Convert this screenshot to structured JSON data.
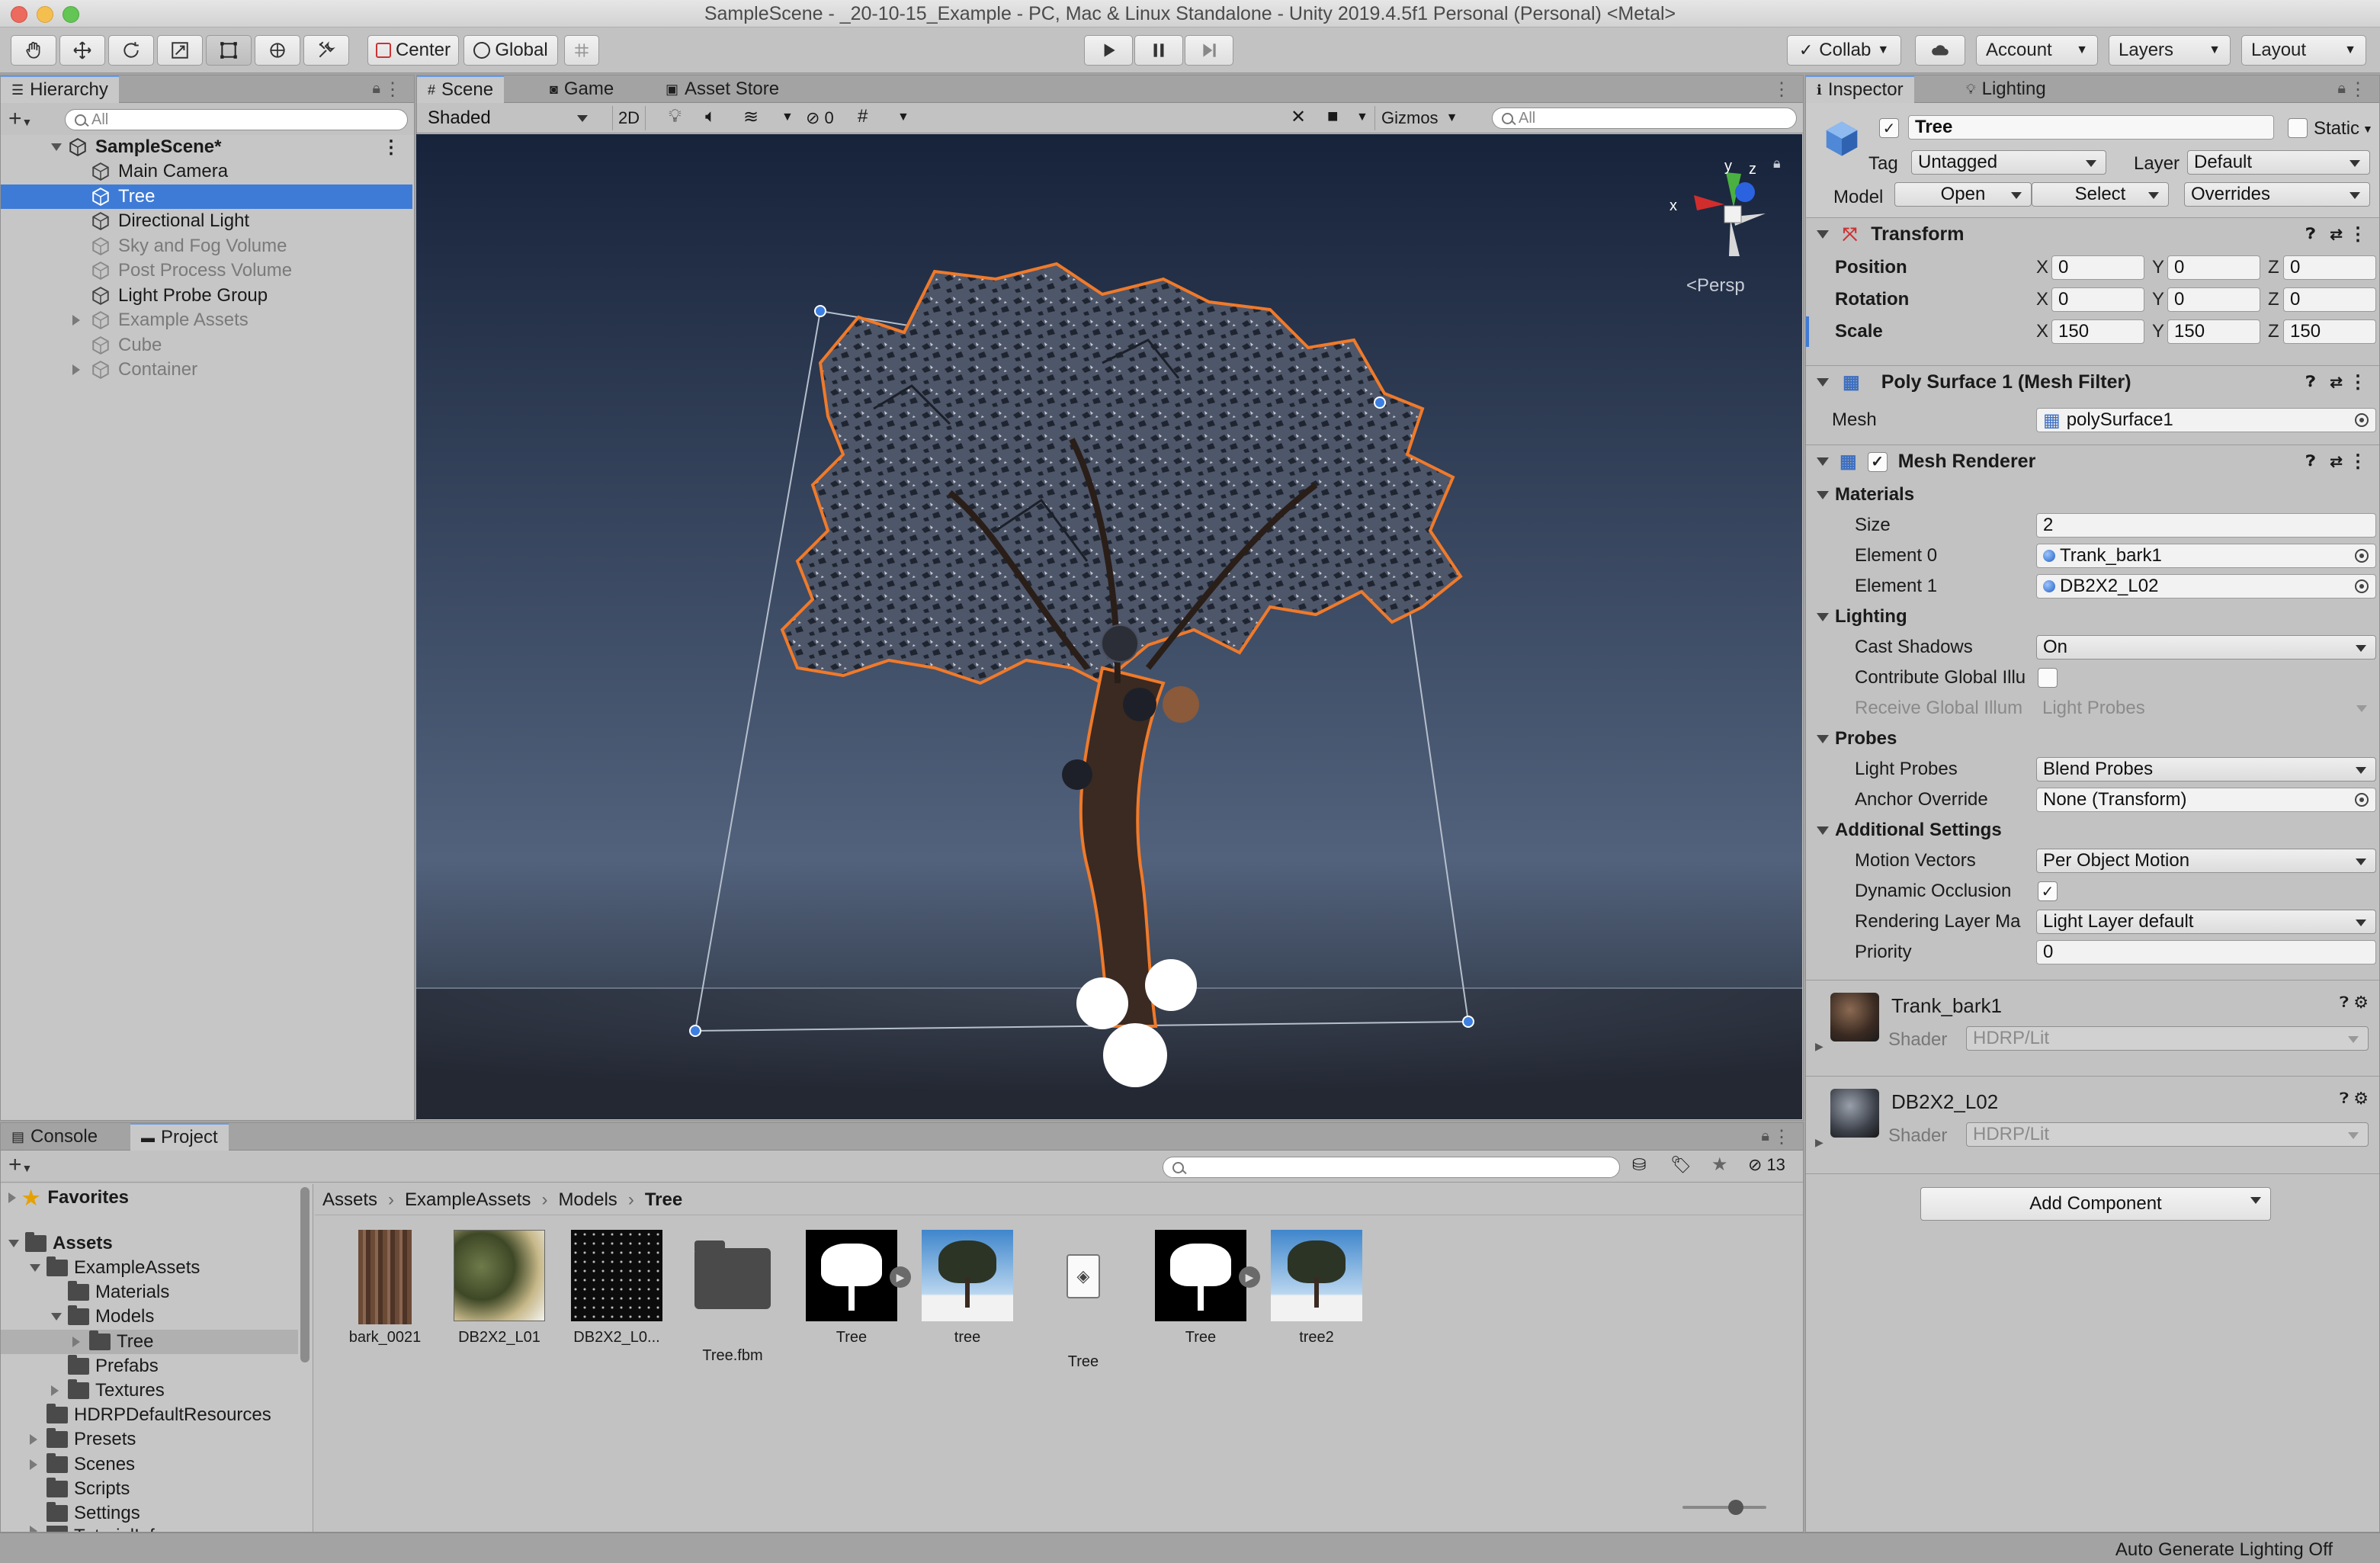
{
  "window": {
    "title": "SampleScene - _20-10-15_Example - PC, Mac & Linux Standalone - Unity 2019.4.5f1 Personal (Personal) <Metal>"
  },
  "toolbar": {
    "pivot_label": "Center",
    "space_label": "Global",
    "collab_label": "Collab",
    "account_label": "Account",
    "layers_label": "Layers",
    "layout_label": "Layout",
    "tools": [
      "hand-tool",
      "move-tool",
      "rotate-tool",
      "scale-tool",
      "rect-tool",
      "transform-tool",
      "custom-tool"
    ],
    "active_tool": "rect-tool"
  },
  "hierarchy": {
    "tab": "Hierarchy",
    "search_placeholder": "All",
    "scene_name": "SampleScene*",
    "items": [
      {
        "label": "Main Camera",
        "dim": false,
        "selected": false
      },
      {
        "label": "Tree",
        "dim": false,
        "selected": true
      },
      {
        "label": "Directional Light",
        "dim": false,
        "selected": false
      },
      {
        "label": "Sky and Fog Volume",
        "dim": true,
        "selected": false
      },
      {
        "label": "Post Process Volume",
        "dim": true,
        "selected": false
      },
      {
        "label": "Light Probe Group",
        "dim": false,
        "selected": false
      },
      {
        "label": "Example Assets",
        "dim": true,
        "selected": false,
        "foldout": true
      },
      {
        "label": "Cube",
        "dim": true,
        "selected": false
      },
      {
        "label": "Container",
        "dim": true,
        "selected": false,
        "foldout": true
      }
    ]
  },
  "scene": {
    "tabs": [
      "Scene",
      "Game",
      "Asset Store"
    ],
    "shading_mode": "Shaded",
    "mode_2d": "2D",
    "hidden_count": "0",
    "gizmos_label": "Gizmos",
    "search_placeholder": "All",
    "projection_label": "Persp",
    "gizmo_axes": {
      "x": "x",
      "y": "y",
      "z": "z"
    },
    "sky_top_color": "#17233a",
    "sky_horizon_color": "#52627c",
    "selection_outline_color": "#f07a2a"
  },
  "inspector": {
    "tabs": [
      "Inspector",
      "Lighting"
    ],
    "object_name": "Tree",
    "static_label": "Static",
    "tag_label": "Tag",
    "tag_value": "Untagged",
    "layer_label": "Layer",
    "layer_value": "Default",
    "model_label": "Model",
    "open_label": "Open",
    "select_label": "Select",
    "overrides_label": "Overrides",
    "transform": {
      "title": "Transform",
      "position": {
        "label": "Position",
        "x": "0",
        "y": "0",
        "z": "0"
      },
      "rotation": {
        "label": "Rotation",
        "x": "0",
        "y": "0",
        "z": "0"
      },
      "scale": {
        "label": "Scale",
        "x": "150",
        "y": "150",
        "z": "150"
      },
      "axis_x": "X",
      "axis_y": "Y",
      "axis_z": "Z"
    },
    "mesh_filter": {
      "title": "Poly Surface 1 (Mesh Filter)",
      "mesh_label": "Mesh",
      "mesh_value": "polySurface1"
    },
    "mesh_renderer": {
      "title": "Mesh Renderer",
      "materials_label": "Materials",
      "size_label": "Size",
      "size_value": "2",
      "element0_label": "Element 0",
      "element0_value": "Trank_bark1",
      "element1_label": "Element 1",
      "element1_value": "DB2X2_L02",
      "lighting_label": "Lighting",
      "cast_shadows_label": "Cast Shadows",
      "cast_shadows_value": "On",
      "contribute_gi_label": "Contribute Global Illu",
      "receive_gi_label": "Receive Global Illum",
      "receive_gi_value": "Light Probes",
      "probes_label": "Probes",
      "light_probes_label": "Light Probes",
      "light_probes_value": "Blend Probes",
      "anchor_override_label": "Anchor Override",
      "anchor_override_value": "None (Transform)",
      "additional_label": "Additional Settings",
      "motion_vectors_label": "Motion Vectors",
      "motion_vectors_value": "Per Object Motion",
      "dynamic_occlusion_label": "Dynamic Occlusion",
      "rendering_layer_label": "Rendering Layer Ma",
      "rendering_layer_value": "Light Layer default",
      "priority_label": "Priority",
      "priority_value": "0"
    },
    "materials": [
      {
        "name": "Trank_bark1",
        "shader_label": "Shader",
        "shader": "HDRP/Lit"
      },
      {
        "name": "DB2X2_L02",
        "shader_label": "Shader",
        "shader": "HDRP/Lit"
      }
    ],
    "add_component_label": "Add Component"
  },
  "bottom": {
    "tabs": [
      "Console",
      "Project"
    ],
    "hidden_count": "13",
    "favorites_label": "Favorites",
    "assets_label": "Assets",
    "folders": [
      {
        "label": "ExampleAssets",
        "level": 1,
        "open": true
      },
      {
        "label": "Materials",
        "level": 2
      },
      {
        "label": "Models",
        "level": 2,
        "open": true
      },
      {
        "label": "Tree",
        "level": 3,
        "selected": true,
        "foldout": true
      },
      {
        "label": "Prefabs",
        "level": 2
      },
      {
        "label": "Textures",
        "level": 2,
        "foldout": true
      },
      {
        "label": "HDRPDefaultResources",
        "level": 1
      },
      {
        "label": "Presets",
        "level": 1,
        "foldout": true
      },
      {
        "label": "Scenes",
        "level": 1,
        "foldout": true
      },
      {
        "label": "Scripts",
        "level": 1
      },
      {
        "label": "Settings",
        "level": 1
      },
      {
        "label": "TutorialInfo",
        "level": 1,
        "foldout": true
      }
    ],
    "breadcrumb": [
      "Assets",
      "ExampleAssets",
      "Models",
      "Tree"
    ],
    "assets": [
      {
        "label": "bark_0021",
        "kind": "bark-texture"
      },
      {
        "label": "DB2X2_L01",
        "kind": "leaf-texture"
      },
      {
        "label": "DB2X2_L0...",
        "kind": "leaf-mask"
      },
      {
        "label": "Tree.fbm",
        "kind": "folder"
      },
      {
        "label": "Tree",
        "kind": "silhouette"
      },
      {
        "label": "tree",
        "kind": "tree-render"
      },
      {
        "label": "Tree",
        "kind": "model-file"
      },
      {
        "label": "Tree",
        "kind": "silhouette"
      },
      {
        "label": "tree2",
        "kind": "tree-render"
      }
    ]
  },
  "status": {
    "text": "Auto Generate Lighting Off"
  }
}
